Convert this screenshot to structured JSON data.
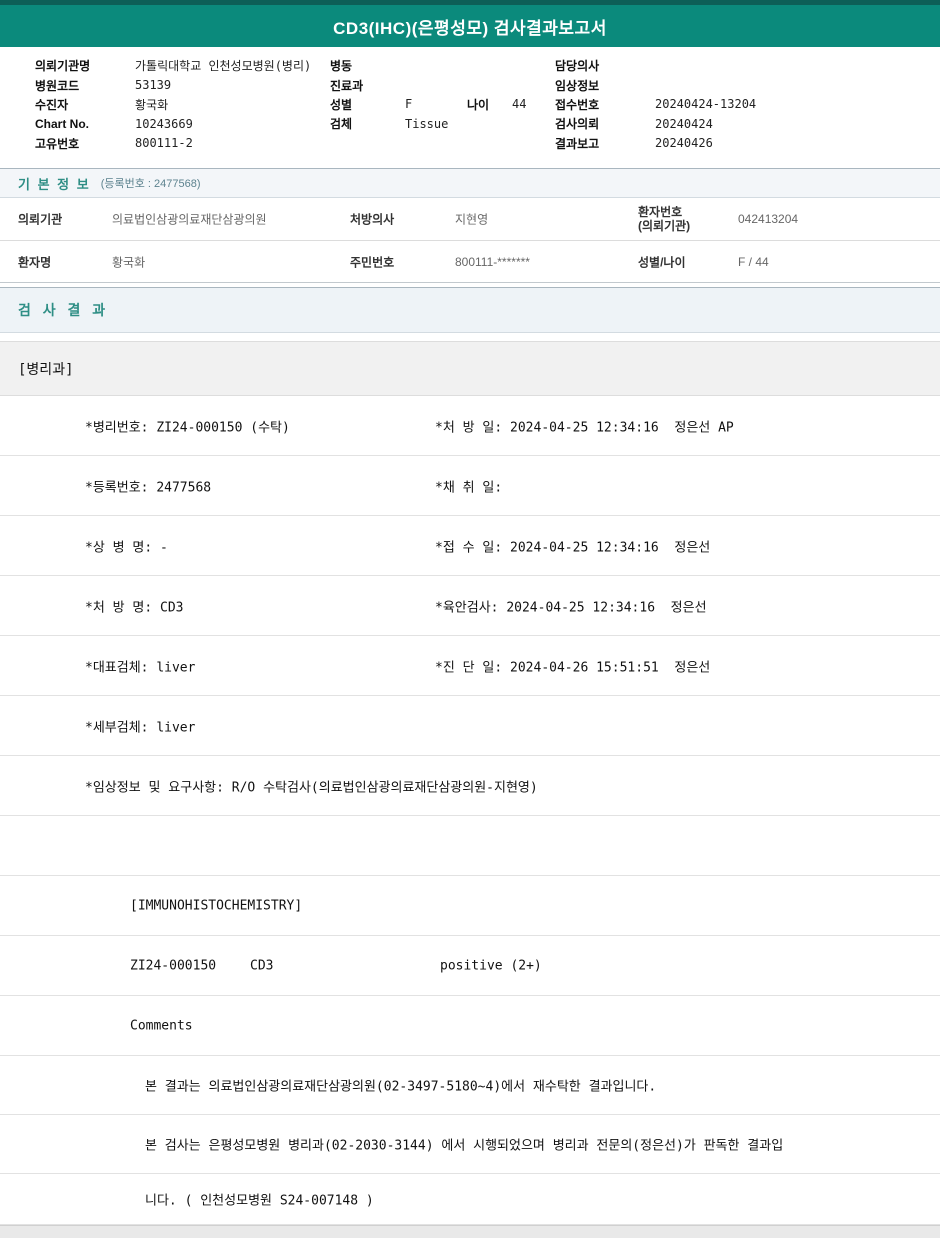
{
  "colors": {
    "header_teal": "#0b8a7c",
    "header_dark_teal": "#0d5f57",
    "section_teal": "#2e8e85"
  },
  "title_bar": {
    "title": "CD3(IHC)(은평성모) 검사결과보고서"
  },
  "patient_header": {
    "left": [
      {
        "label": "의뢰기관명",
        "value": "가톨릭대학교 인천성모병원(병리)"
      },
      {
        "label": "병원코드",
        "value": "53139"
      },
      {
        "label": "수진자",
        "value": "황국화"
      },
      {
        "label": "Chart No.",
        "value": "10243669"
      },
      {
        "label": "고유번호",
        "value": "800111-2"
      }
    ],
    "middle": {
      "ward_label": "병동",
      "ward_value": "",
      "dept_label": "진료과",
      "dept_value": "",
      "sex_label": "성별",
      "sex_value": "F",
      "age_label": "나이",
      "age_value": "44",
      "specimen_label": "검체",
      "specimen_value": "Tissue"
    },
    "right": [
      {
        "label": "담당의사",
        "value": ""
      },
      {
        "label": "임상정보",
        "value": ""
      },
      {
        "label": "접수번호",
        "value": "20240424-13204"
      },
      {
        "label": "검사의뢰",
        "value": "20240424"
      },
      {
        "label": "결과보고",
        "value": "20240426"
      }
    ]
  },
  "basic_info": {
    "section_title": "기 본 정 보",
    "section_subtitle": "(등록번호 : 2477568)",
    "row1": {
      "c1_label": "의뢰기관",
      "c1_value": "의료법인삼광의료재단삼광의원",
      "c2_label": "처방의사",
      "c2_value": "지현영",
      "c3_label_line1": "환자번호",
      "c3_label_line2": "(의뢰기관)",
      "c3_value": "042413204"
    },
    "row2": {
      "c1_label": "환자명",
      "c1_value": "황국화",
      "c2_label": "주민번호",
      "c2_value": "800111-*******",
      "c3_label": "성별/나이",
      "c3_value": "F / 44"
    }
  },
  "results": {
    "section_title": "검 사 결 과",
    "department": "[병리과]",
    "details": [
      {
        "left": "*병리번호: ZI24-000150 (수탁)",
        "right": "*처 방 일: 2024-04-25 12:34:16  정은선 AP"
      },
      {
        "left": "*등록번호: 2477568",
        "right": "*채 취 일:"
      },
      {
        "left": "*상 병 명: -",
        "right": "*접 수 일: 2024-04-25 12:34:16  정은선"
      },
      {
        "left": "*처 방 명: CD3",
        "right": "*육안검사: 2024-04-25 12:34:16  정은선"
      },
      {
        "left": "*대표검체: liver",
        "right": "*진 단 일: 2024-04-26 15:51:51  정은선"
      },
      {
        "left": "*세부검체: liver",
        "right": ""
      },
      {
        "left": "*임상정보 및 요구사항: R/O 수탁검사(의료법인삼광의료재단삼광의원-지현영)",
        "right": ""
      }
    ],
    "ihc": {
      "header": "[IMMUNOHISTOCHEMISTRY]",
      "row": {
        "code": "ZI24-000150",
        "test": "CD3",
        "result": "positive (2+)"
      },
      "comments_label": "Comments",
      "comment_lines": [
        "본 결과는 의료법인삼광의료재단삼광의원(02-3497-5180~4)에서 재수탁한 결과입니다.",
        "본 검사는 은평성모병원 병리과(02-2030-3144) 에서 시행되었으며 병리과 전문의(정은선)가 판독한 결과입",
        "니다. ( 인천성모병원 S24-007148 )"
      ]
    }
  }
}
